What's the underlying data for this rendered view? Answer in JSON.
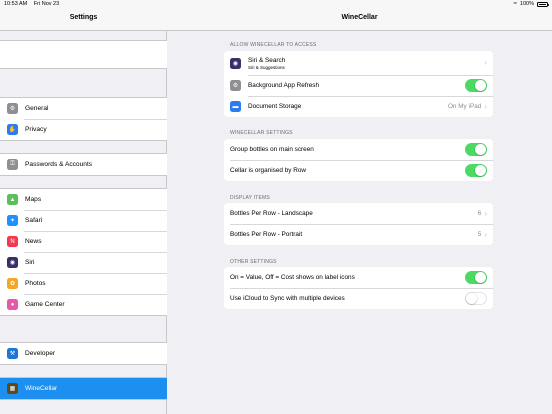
{
  "status": {
    "time": "10:53 AM",
    "date": "Fri Nov 23",
    "battery": "100%"
  },
  "sidebar": {
    "title": "Settings",
    "groups": [
      [
        {
          "label": "General",
          "icon": "gear-icon",
          "color": "#8e8e93"
        },
        {
          "label": "Privacy",
          "icon": "hand-icon",
          "color": "#2b7cf2"
        }
      ],
      [
        {
          "label": "Passwords & Accounts",
          "icon": "key-icon",
          "color": "#8e8e93"
        }
      ],
      [
        {
          "label": "Maps",
          "icon": "maps-icon",
          "color": "#5bbf5a"
        },
        {
          "label": "Safari",
          "icon": "compass-icon",
          "color": "#1e90ff"
        },
        {
          "label": "News",
          "icon": "news-icon",
          "color": "#f2394f"
        },
        {
          "label": "Siri",
          "icon": "siri-icon",
          "color": "#3a2f6b"
        },
        {
          "label": "Photos",
          "icon": "photos-icon",
          "color": "#f5a623"
        },
        {
          "label": "Game Center",
          "icon": "game-center-icon",
          "color": "#e45aa4"
        }
      ],
      [
        {
          "label": "Developer",
          "icon": "hammer-icon",
          "color": "#1c76d8"
        }
      ],
      [
        {
          "label": "WineCellar",
          "icon": "winecellar-icon",
          "color": "#5a4a1c",
          "selected": true
        }
      ]
    ]
  },
  "detail": {
    "title": "WineCellar",
    "sections": [
      {
        "header": "ALLOW WINECELLAR TO ACCESS",
        "rows": [
          {
            "label": "Siri & Search",
            "sub": "Siri & Suggestions",
            "icon": "siri-icon",
            "color": "#3a2f6b",
            "kind": "chevron"
          },
          {
            "label": "Background App Refresh",
            "icon": "gear-icon",
            "color": "#8e8e93",
            "kind": "toggle",
            "on": true
          },
          {
            "label": "Document Storage",
            "icon": "folder-icon",
            "color": "#2b7cf2",
            "kind": "value",
            "value": "On My iPad"
          }
        ]
      },
      {
        "header": "WINECELLAR SETTINGS",
        "rows": [
          {
            "label": "Group bottles on main screen",
            "kind": "toggle",
            "on": true
          },
          {
            "label": "Cellar is organised by Row",
            "kind": "toggle",
            "on": true
          }
        ]
      },
      {
        "header": "DISPLAY ITEMS",
        "rows": [
          {
            "label": "Bottles Per Row - Landscape",
            "kind": "value",
            "value": "6"
          },
          {
            "label": "Bottles Per Row - Portrait",
            "kind": "value",
            "value": "5"
          }
        ]
      },
      {
        "header": "OTHER SETTINGS",
        "rows": [
          {
            "label": "On = Value, Off = Cost shows on label icons",
            "kind": "toggle",
            "on": true
          },
          {
            "label": "Use iCloud to Sync with multiple devices",
            "kind": "toggle",
            "on": false
          }
        ]
      }
    ]
  }
}
